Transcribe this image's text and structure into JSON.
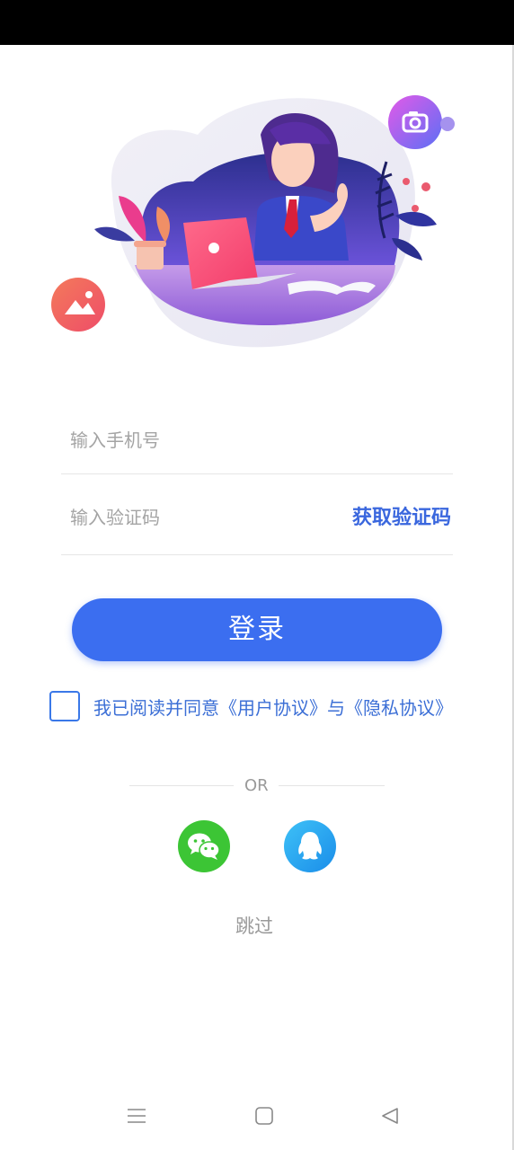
{
  "form": {
    "phone_placeholder": "输入手机号",
    "code_placeholder": "输入验证码",
    "get_code_label": "获取验证码"
  },
  "login_label": "登录",
  "agreement": {
    "checked": false,
    "text": "我已阅读并同意《用户协议》与《隐私协议》"
  },
  "divider_label": "OR",
  "social": [
    {
      "icon": "wechat-icon"
    },
    {
      "icon": "qq-icon"
    }
  ],
  "skip_label": "跳过",
  "nav": {
    "menu_icon": "menu-icon",
    "home_icon": "home-icon",
    "back_icon": "back-icon"
  },
  "colors": {
    "accent": "#3b6ef0",
    "link": "#3a67de",
    "wechat": "#3cc535",
    "qq": "#1a8de9"
  }
}
